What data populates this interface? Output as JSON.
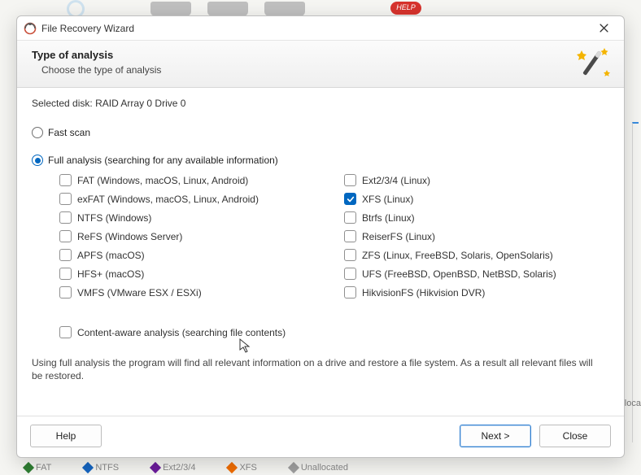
{
  "background": {
    "help": "HELP",
    "bottom": [
      "FAT",
      "NTFS",
      "Ext2/3/4",
      "XFS",
      "Unallocated"
    ],
    "swatch_colors": [
      "#2e7d32",
      "#1565c0",
      "#6a1b9a",
      "#ef6c00",
      "#9e9e9e"
    ],
    "right_label": "Alloca"
  },
  "titlebar": {
    "title": "File Recovery Wizard"
  },
  "header": {
    "title": "Type of analysis",
    "subtitle": "Choose the type of analysis"
  },
  "selected_disk_label": "Selected disk:",
  "selected_disk_value": "RAID Array 0 Drive 0",
  "options": {
    "fast": {
      "label": "Fast scan",
      "checked": false
    },
    "full": {
      "label": "Full analysis (searching for any available information)",
      "checked": true
    }
  },
  "filesystems": {
    "left": [
      {
        "name": "fat",
        "label": "FAT (Windows, macOS, Linux, Android)",
        "checked": false
      },
      {
        "name": "exfat",
        "label": "exFAT (Windows, macOS, Linux, Android)",
        "checked": false
      },
      {
        "name": "ntfs",
        "label": "NTFS (Windows)",
        "checked": false
      },
      {
        "name": "refs",
        "label": "ReFS (Windows Server)",
        "checked": false
      },
      {
        "name": "apfs",
        "label": "APFS (macOS)",
        "checked": false
      },
      {
        "name": "hfs",
        "label": "HFS+ (macOS)",
        "checked": false
      },
      {
        "name": "vmfs",
        "label": "VMFS (VMware ESX / ESXi)",
        "checked": false
      }
    ],
    "right": [
      {
        "name": "ext",
        "label": "Ext2/3/4 (Linux)",
        "checked": false
      },
      {
        "name": "xfs",
        "label": "XFS (Linux)",
        "checked": true
      },
      {
        "name": "btrfs",
        "label": "Btrfs (Linux)",
        "checked": false
      },
      {
        "name": "reiser",
        "label": "ReiserFS (Linux)",
        "checked": false
      },
      {
        "name": "zfs",
        "label": "ZFS (Linux, FreeBSD, Solaris, OpenSolaris)",
        "checked": false
      },
      {
        "name": "ufs",
        "label": "UFS (FreeBSD, OpenBSD, NetBSD, Solaris)",
        "checked": false
      },
      {
        "name": "hik",
        "label": "HikvisionFS (Hikvision DVR)",
        "checked": false
      }
    ]
  },
  "content_aware": {
    "label": "Content-aware analysis (searching file contents)",
    "checked": false
  },
  "description": "Using full analysis the program will find all relevant information on a drive and restore a file system. As a result all relevant files will be restored.",
  "buttons": {
    "help": "Help",
    "next": "Next >",
    "close": "Close"
  }
}
